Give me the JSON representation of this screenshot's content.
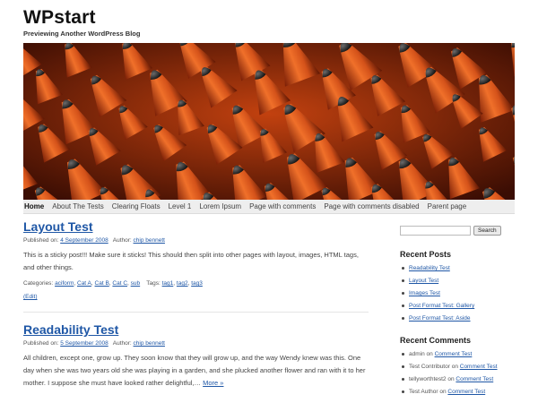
{
  "site": {
    "title": "WPstart",
    "description": "Previewing Another WordPress Blog"
  },
  "nav": {
    "items": [
      "Home",
      "About The Tests",
      "Clearing Floats",
      "Level 1",
      "Lorem Ipsum",
      "Page with comments",
      "Page with comments disabled",
      "Parent page"
    ]
  },
  "posts": [
    {
      "title": "Layout Test",
      "published_label": "Published on:",
      "date": "4 September 2008",
      "author_label": "Author:",
      "author": "chip bennett",
      "excerpt": "This is a sticky post!!! Make sure it sticks! This should then split into other pages with layout, images, HTML tags, and other things.",
      "categories_label": "Categories:",
      "categories": [
        "aciform",
        "Cat A",
        "Cat B",
        "Cat C",
        "sub"
      ],
      "tags_label": "Tags:",
      "tags": [
        "tag1",
        "tag2",
        "tag3"
      ],
      "edit_label": "(Edit)"
    },
    {
      "title": "Readability Test",
      "published_label": "Published on:",
      "date": "5 September 2008",
      "author_label": "Author:",
      "author": "chip bennett",
      "excerpt": "All children, except one, grow up. They soon know that they will grow up, and the way Wendy knew was this. One day when she was two years old she was playing in a garden, and she plucked another flower and ran with it to her mother. I suppose she must have looked rather delightful,…",
      "more_label": "More »"
    }
  ],
  "sidebar": {
    "search_button": "Search",
    "recent_posts_title": "Recent Posts",
    "recent_posts": [
      "Readability Test",
      "Layout Test",
      "Images Test",
      "Post Format Test: Gallery",
      "Post Format Test: Aside"
    ],
    "recent_comments_title": "Recent Comments",
    "recent_comments": [
      {
        "author": "admin",
        "on": "on",
        "post": "Comment Test"
      },
      {
        "author": "Test Contributor",
        "on": "on",
        "post": "Comment Test"
      },
      {
        "author": "tellyworthtest2",
        "on": "on",
        "post": "Comment Test"
      },
      {
        "author": "Test Author",
        "on": "on",
        "post": "Comment Test"
      }
    ]
  },
  "colors": {
    "link": "#1f57a6",
    "header_image_base": "#8a2a0c"
  }
}
